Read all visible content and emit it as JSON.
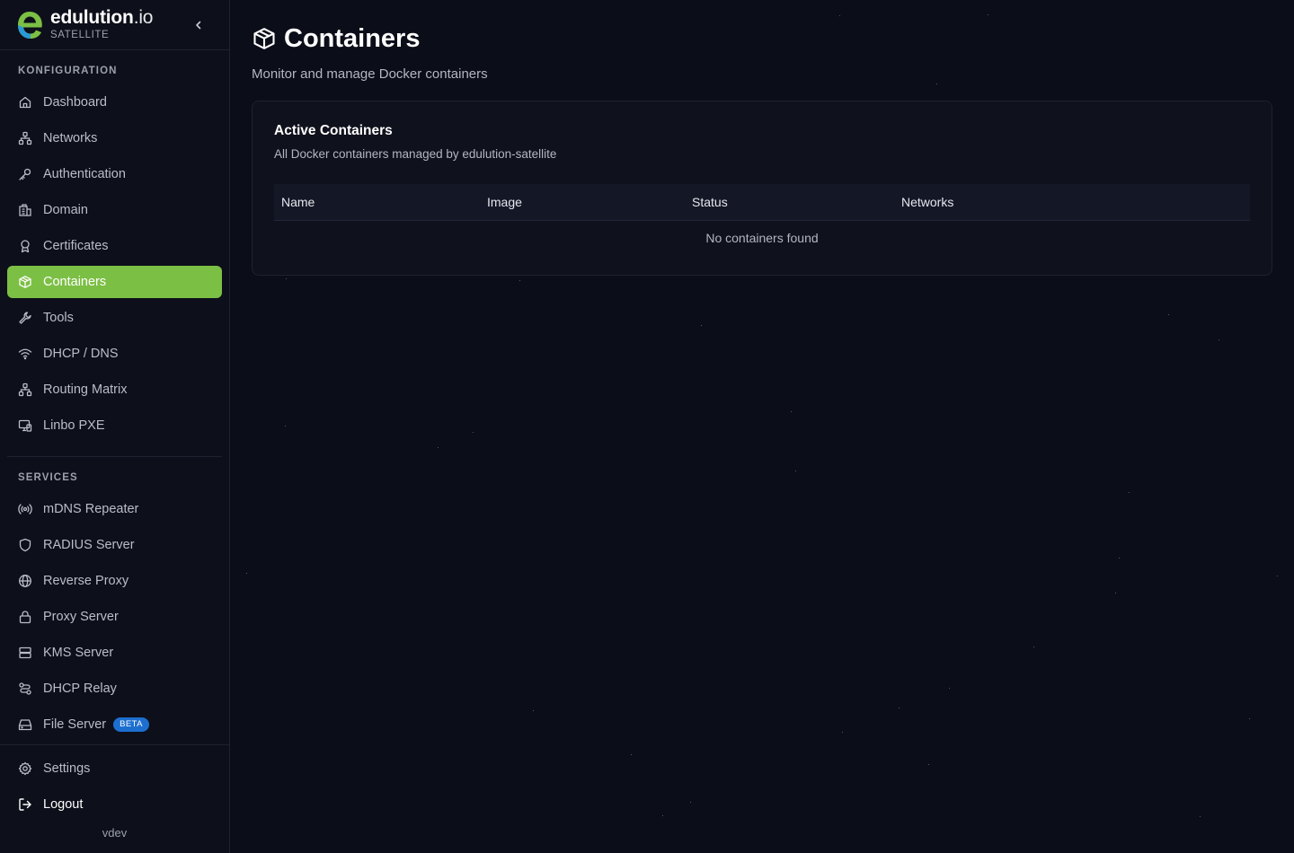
{
  "brand": {
    "name": "edulution",
    "suffix": ".io",
    "subtitle": "SATELLITE"
  },
  "sidebar": {
    "section_config": "KONFIGURATION",
    "config_items": [
      {
        "label": "Dashboard",
        "icon": "home-icon"
      },
      {
        "label": "Networks",
        "icon": "network-icon"
      },
      {
        "label": "Authentication",
        "icon": "key-icon"
      },
      {
        "label": "Domain",
        "icon": "building-icon"
      },
      {
        "label": "Certificates",
        "icon": "award-icon"
      },
      {
        "label": "Containers",
        "icon": "box-icon",
        "active": true
      },
      {
        "label": "Tools",
        "icon": "wrench-icon"
      },
      {
        "label": "DHCP / DNS",
        "icon": "wifi-icon"
      },
      {
        "label": "Routing Matrix",
        "icon": "network-icon"
      },
      {
        "label": "Linbo PXE",
        "icon": "monitor-icon"
      }
    ],
    "section_services": "SERVICES",
    "service_items": [
      {
        "label": "mDNS Repeater",
        "icon": "radio-icon"
      },
      {
        "label": "RADIUS Server",
        "icon": "shield-icon"
      },
      {
        "label": "Reverse Proxy",
        "icon": "globe-icon"
      },
      {
        "label": "Proxy Server",
        "icon": "lock-icon"
      },
      {
        "label": "KMS Server",
        "icon": "server-icon"
      },
      {
        "label": "DHCP Relay",
        "icon": "relay-icon"
      },
      {
        "label": "File Server",
        "icon": "drive-icon",
        "badge": "BETA"
      }
    ],
    "settings_label": "Settings",
    "logout_label": "Logout",
    "version": "vdev"
  },
  "header": {
    "title": "Containers",
    "subtitle": "Monitor and manage Docker containers"
  },
  "card": {
    "title": "Active Containers",
    "description": "All Docker containers managed by edulution-satellite",
    "columns": [
      "Name",
      "Image",
      "Status",
      "Networks"
    ],
    "empty_message": "No containers found"
  },
  "colors": {
    "accent": "#7cbf45",
    "background": "#0b0d18",
    "badge": "#1d6fcf"
  }
}
